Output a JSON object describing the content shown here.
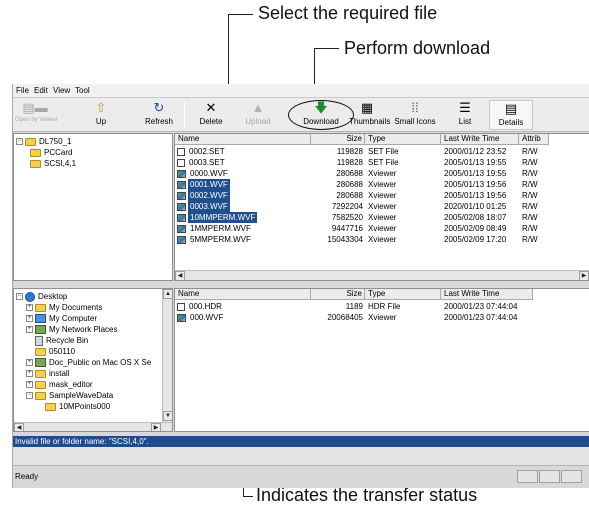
{
  "annotations": {
    "select_file": "Select the required file",
    "perform_download": "Perform download",
    "transfer_status": "Indicates the transfer status"
  },
  "menu": [
    "File",
    "Edit",
    "View",
    "Tool"
  ],
  "toolbar": {
    "open_viewer": "Open by Viewer",
    "up": "Up",
    "refresh": "Refresh",
    "delete": "Delete",
    "upload": "Upload",
    "download": "Download",
    "thumbnails": "Thumbnails",
    "small_icons": "Small Icons",
    "list": "List",
    "details": "Details"
  },
  "remote_tree": [
    {
      "label": "DL750_1",
      "expander": "−"
    },
    {
      "label": "PCCard",
      "expander": ""
    },
    {
      "label": "SCSI,4,1",
      "expander": ""
    }
  ],
  "remote_columns": [
    "Name",
    "Size",
    "Type",
    "Last Write Time",
    "Attrib"
  ],
  "remote_files": [
    {
      "name": "0002.SET",
      "size": "119828",
      "type": "SET File",
      "time": "2000/01/12 23:52",
      "attr": "R/W",
      "icon": "set",
      "selected": false
    },
    {
      "name": "0003.SET",
      "size": "119828",
      "type": "SET File",
      "time": "2005/01/13 19:55",
      "attr": "R/W",
      "icon": "set",
      "selected": false
    },
    {
      "name": "0000.WVF",
      "size": "280688",
      "type": "Xviewer",
      "time": "2005/01/13 19:55",
      "attr": "R/W",
      "icon": "wvf",
      "selected": false
    },
    {
      "name": "0001.WVF",
      "size": "280688",
      "type": "Xviewer",
      "time": "2005/01/13 19:56",
      "attr": "R/W",
      "icon": "wvf",
      "selected": true
    },
    {
      "name": "0002.WVF",
      "size": "280688",
      "type": "Xviewer",
      "time": "2005/01/13 19:56",
      "attr": "R/W",
      "icon": "wvf",
      "selected": true
    },
    {
      "name": "0003.WVF",
      "size": "7292204",
      "type": "Xviewer",
      "time": "2020/01/10 01:25",
      "attr": "R/W",
      "icon": "wvf",
      "selected": true
    },
    {
      "name": "10MMPERM.WVF",
      "size": "7582520",
      "type": "Xviewer",
      "time": "2005/02/08 18:07",
      "attr": "R/W",
      "icon": "wvf",
      "selected": true
    },
    {
      "name": "1MMPERM.WVF",
      "size": "9447716",
      "type": "Xviewer",
      "time": "2005/02/09 08:49",
      "attr": "R/W",
      "icon": "wvf",
      "selected": false
    },
    {
      "name": "5MMPERM.WVF",
      "size": "15043304",
      "type": "Xviewer",
      "time": "2005/02/09 17:20",
      "attr": "R/W",
      "icon": "wvf",
      "selected": false
    }
  ],
  "local_tree": [
    {
      "label": "Desktop",
      "expander": "−",
      "icon": "globe",
      "indent": 0
    },
    {
      "label": "My Documents",
      "expander": "+",
      "icon": "folder",
      "indent": 1
    },
    {
      "label": "My Computer",
      "expander": "+",
      "icon": "pc",
      "indent": 1
    },
    {
      "label": "My Network Places",
      "expander": "+",
      "icon": "net",
      "indent": 1
    },
    {
      "label": "Recycle Bin",
      "expander": "",
      "icon": "bin",
      "indent": 1
    },
    {
      "label": "050110",
      "expander": "",
      "icon": "folder",
      "indent": 1
    },
    {
      "label": "Doc_Public on Mac OS X Se",
      "expander": "+",
      "icon": "net",
      "indent": 1
    },
    {
      "label": "install",
      "expander": "+",
      "icon": "folder",
      "indent": 1
    },
    {
      "label": "mask_editor",
      "expander": "+",
      "icon": "folder",
      "indent": 1
    },
    {
      "label": "SampleWaveData",
      "expander": "−",
      "icon": "folder",
      "indent": 1
    },
    {
      "label": "10MPoints000",
      "expander": "",
      "icon": "folder",
      "indent": 2
    }
  ],
  "local_columns": [
    "Name",
    "Size",
    "Type",
    "Last Write Time"
  ],
  "local_files": [
    {
      "name": "000.HDR",
      "size": "1189",
      "type": "HDR File",
      "time": "2000/01/23 07:44:04",
      "icon": "set"
    },
    {
      "name": "000.WVF",
      "size": "20068405",
      "type": "Xviewer",
      "time": "2000/01/23 07:44:04",
      "icon": "wvf"
    }
  ],
  "error_message": "Invalid file or folder name: \"SCSI,4,0\".",
  "status": "Ready"
}
